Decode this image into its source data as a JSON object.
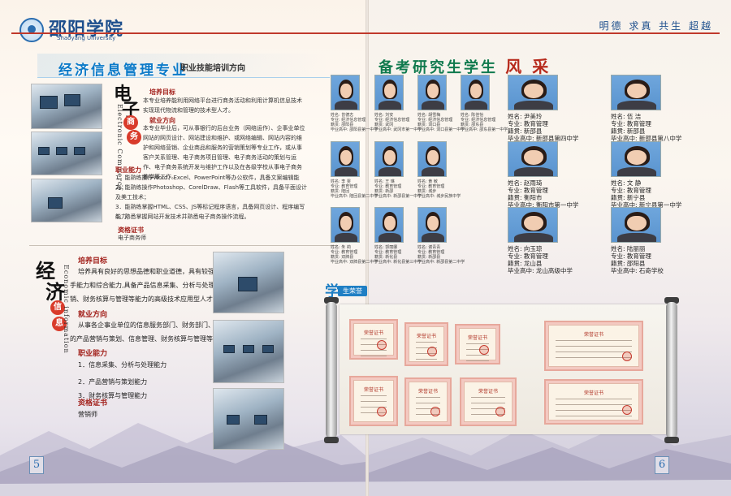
{
  "header": {
    "school_name": "邵阳学院",
    "school_en": "Shaoyang University",
    "motto": "明德  求真  共生  超越"
  },
  "left_page": {
    "banner_title": "经济信息管理专业",
    "banner_subtitle": "职业技能培训方向",
    "ecommerce": {
      "char_1": "电",
      "char_2": "子",
      "badge_1": "商",
      "badge_2": "务",
      "en_label": "Electronic Commerce",
      "training_goal_heading": "培养目标",
      "training_goal_text": "本专业培养能利用网络平台进行商务活动和利用计算机信息技术实现现代物流和管理的技术型人才。",
      "employment_heading": "就业方向",
      "employment_text": "本专业毕业后，可从事银行的后台业务（网络运作）、企事业单位网站的网页设计、网站建设和维护、或网络编辑、网站内容的维护和网络营销、企业商品和服务的营销策划等专业工作，或从事客户关系管理、电子商务项目管理、电子商务活动的策划与运作、电子商务系统开发与维护工作以及在各级学校从事电子商务教学等工作。",
      "ability_heading": "职业能力",
      "abilities": [
        "1．能熟练操作Word、Excel、PowerPoint等办公软件，具备文案编辑能力；",
        "2．能熟练操作Photoshop、CorelDraw、Flash等工具软件，具备平面设计及美工技术；",
        "3．能熟练掌握HTML、CSS、JS等标记程序语言，具备网页设计、程序编写能力；",
        "4．熟悉掌握网站开发技术并熟悉电子商务操作流程。"
      ],
      "cert_heading": "资格证书",
      "cert_text": "电子商务师"
    },
    "econinfo": {
      "char_1": "经",
      "char_2": "济",
      "badge_1": "信",
      "badge_2": "息",
      "en_label": "Economic information",
      "training_goal_heading": "培养目标",
      "training_goal_text_1": "培养具有良好的思想品德和职业道德，具有较强的实践动",
      "training_goal_text_2": "手能力和综合能力,具备产品信息采集、分析与处理、产品营",
      "training_goal_text_3": "销、财务核算与管理等能力的高级技术应用型人才。",
      "employment_heading": "就业方向",
      "employment_text_1": "从事各企事业单位的信息服务部门、财务部门、营销部门",
      "employment_text_2": "的产品营销与策划、信息管理、财务核算与管理等工作;",
      "ability_heading": "职业能力",
      "abilities": [
        "1．信息采集、分析与处理能力",
        "2．产品营销与策划能力",
        "3．财务核算与管理能力"
      ],
      "cert_heading": "资格证书",
      "cert_text": "营销师"
    },
    "page_number": "5"
  },
  "right_page": {
    "title_main": "备考研究生学生",
    "title_accent": "风 采",
    "honor_big": "学",
    "honor_label": "生荣誉",
    "page_number": "6",
    "students_small": [
      {
        "l1": "姓名: 曾德志",
        "l2": "专业: 经济信息管理",
        "l3": "籍贯: 邵阳县",
        "l4": "毕业高中: 邵阳县第一中学"
      },
      {
        "l1": "姓名: 刘安",
        "l2": "专业: 经济信息管理",
        "l3": "籍贯: 武冈",
        "l4": "毕业高中: 武冈市第一中学"
      },
      {
        "l1": "姓名: 胡雪梅",
        "l2": "专业: 经济信息管理",
        "l3": "籍贯: 洞口县",
        "l4": "毕业高中: 洞口县第一中学"
      },
      {
        "l1": "姓名: 陈佳怡",
        "l2": "专业: 经济信息管理",
        "l3": "籍贯: 邵东县",
        "l4": "毕业高中: 邵东县第一中学"
      },
      {
        "l1": "姓名: 李 雯",
        "l2": "专业: 教育管理",
        "l3": "籍贯: 隆回",
        "l4": "毕业高中: 隆回县第二中学"
      },
      {
        "l1": "姓名: 王 琳",
        "l2": "专业: 教育管理",
        "l3": "籍贯: 新邵",
        "l4": "毕业高中: 新邵县第一中学"
      },
      {
        "l1": "姓名: 黄 敏",
        "l2": "专业: 教育管理",
        "l3": "籍贯: 城步",
        "l4": "毕业高中: 城步民族中学"
      },
      {
        "l1": "姓名: 朱 莉",
        "l2": "专业: 教育管理",
        "l3": "籍贯: 双牌县",
        "l4": "毕业高中: 双牌县第二中学"
      },
      {
        "l1": "姓名: 郭丽娜",
        "l2": "专业: 教育管理",
        "l3": "籍贯: 新化县",
        "l4": "毕业高中: 新化县第三中学"
      },
      {
        "l1": "姓名: 谢青青",
        "l2": "专业: 教育管理",
        "l3": "籍贯: 新邵县",
        "l4": "毕业高中: 新邵县第二中学"
      }
    ],
    "students_large": [
      {
        "l1": "姓名: 尹美玲",
        "l2": "专业: 教育管理",
        "l3": "籍贯: 新邵县",
        "l4": "毕业高中: 新邵县第四中学"
      },
      {
        "l1": "姓名: 伍 洁",
        "l2": "专业: 教育管理",
        "l3": "籍贯: 新邵县",
        "l4": "毕业高中: 新邵县第八中学"
      },
      {
        "l1": "姓名: 赵雨琦",
        "l2": "专业: 教育管理",
        "l3": "籍贯: 衡阳市",
        "l4": "毕业高中: 衡阳市第一中学"
      },
      {
        "l1": "姓名: 文 静",
        "l2": "专业: 教育管理",
        "l3": "籍贯: 新宁县",
        "l4": "毕业高中: 新宁县第一中学"
      },
      {
        "l1": "姓名: 向玉琼",
        "l2": "专业: 教育管理",
        "l3": "籍贯: 龙山县",
        "l4": "毕业高中: 龙山高级中学"
      },
      {
        "l1": "姓名: 陆丽丽",
        "l2": "专业: 教育管理",
        "l3": "籍贯: 邵阳县",
        "l4": "毕业高中: 石奇学校"
      }
    ],
    "certs": [
      {
        "title": "荣誉证书"
      },
      {
        "title": "荣誉证书"
      },
      {
        "title": "荣誉证书"
      },
      {
        "title": "荣誉证书"
      },
      {
        "title": "荣誉证书"
      },
      {
        "title": "荣誉证书"
      },
      {
        "title": "荣誉证书"
      },
      {
        "title": "荣誉证书"
      }
    ]
  }
}
